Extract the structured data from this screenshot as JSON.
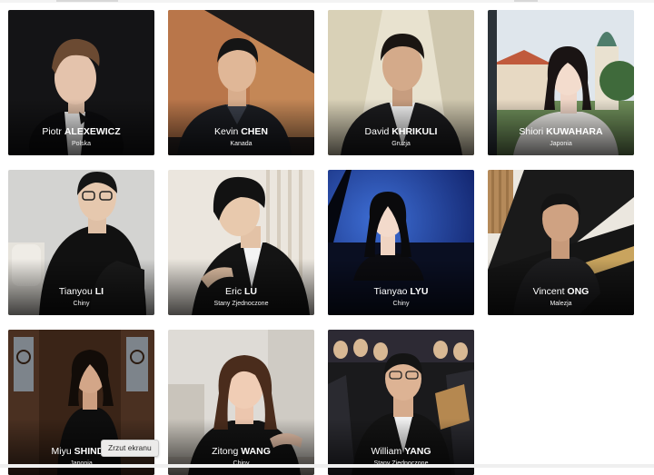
{
  "pianists": [
    {
      "first": "Piotr",
      "last": "ALEXEWICZ",
      "country": "Polska"
    },
    {
      "first": "Kevin",
      "last": "CHEN",
      "country": "Kanada"
    },
    {
      "first": "David",
      "last": "KHRIKULI",
      "country": "Gruzja"
    },
    {
      "first": "Shiori",
      "last": "KUWAHARA",
      "country": "Japonia"
    },
    {
      "first": "Tianyou",
      "last": "LI",
      "country": "Chiny"
    },
    {
      "first": "Eric",
      "last": "LU",
      "country": "Stany Zjednoczone"
    },
    {
      "first": "Tianyao",
      "last": "LYU",
      "country": "Chiny"
    },
    {
      "first": "Vincent",
      "last": "ONG",
      "country": "Malezja"
    },
    {
      "first": "Miyu",
      "last": "SHINDO",
      "country": "Japonia"
    },
    {
      "first": "Zitong",
      "last": "WANG",
      "country": "Chiny"
    },
    {
      "first": "William",
      "last": "YANG",
      "country": "Stany Zjednoczone"
    }
  ],
  "tooltip": "Zrzut ekranu"
}
